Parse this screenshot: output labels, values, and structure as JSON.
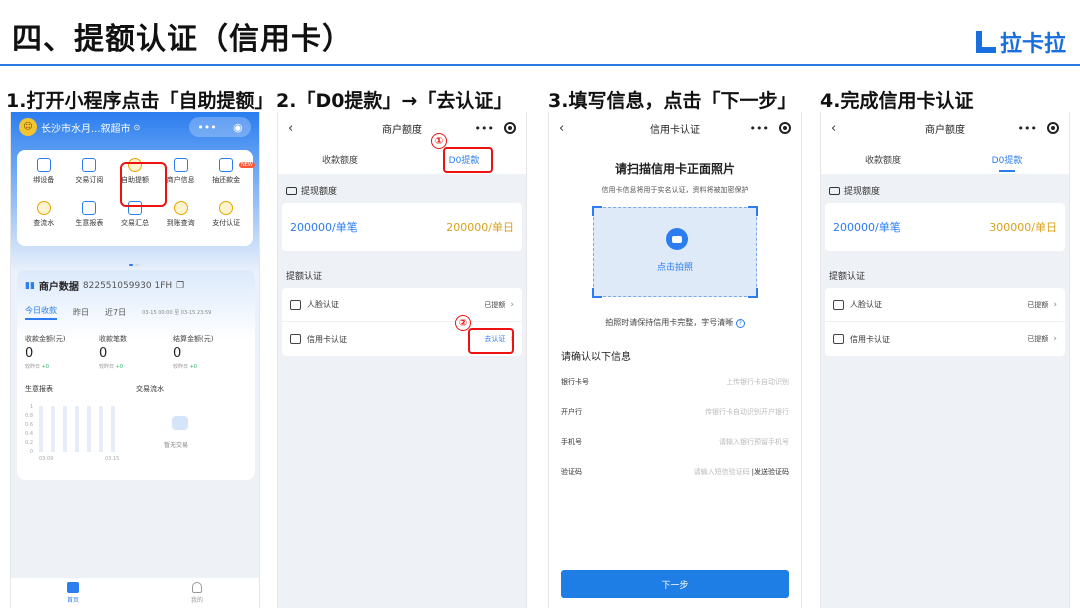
{
  "slide": {
    "title": "四、提额认证（信用卡）",
    "logo": "拉卡拉",
    "steps": [
      "1.打开小程序点击「自助提额」",
      "2.「D0提款」→「去认证」",
      "3.填写信息，点击「下一步」",
      "4.完成信用卡认证"
    ]
  },
  "colors": {
    "accent": "#2b7df0",
    "highlight": "#e11111",
    "quota_gold": "#d9a21a"
  },
  "p1": {
    "store": "长沙市水月...叙超市",
    "caps_more": "•••",
    "grid": [
      "绑设备",
      "交易订阅",
      "自助提额",
      "商户信息",
      "抽还款金",
      "查流水",
      "生意报表",
      "交易汇总",
      "到账查询",
      "支付认证"
    ],
    "data_title": "商户数据",
    "merchant_no": "822551059930 1FH",
    "tabs": [
      "今日收款",
      "昨日",
      "近7日"
    ],
    "range": "03-15 00:00 至 03-15 23:59",
    "metrics": [
      {
        "label": "收款金额(元)",
        "value": "0",
        "yesterday": "较昨日",
        "delta": "+0"
      },
      {
        "label": "收款笔数",
        "value": "0",
        "yesterday": "较昨日",
        "delta": "+0"
      },
      {
        "label": "结算金额(元)",
        "value": "0",
        "yesterday": "较昨日",
        "delta": "+0"
      }
    ],
    "report_label": "生意报表",
    "flow_label": "交易流水",
    "chart_ticks": [
      "1",
      "0.8",
      "0.6",
      "0.4",
      "0.2",
      "0"
    ],
    "chart_dates": [
      "03.09",
      "03.15"
    ],
    "no_trade": "暂无交易",
    "tabbar": [
      "首页",
      "我的"
    ]
  },
  "p2": {
    "title": "商户额度",
    "tabs": [
      "收款额度",
      "D0提款"
    ],
    "withdraw_label": "提现额度",
    "quota_single": "200000/单笔",
    "quota_daily": "200000/单日",
    "auth_title": "提额认证",
    "rows": [
      {
        "label": "人脸认证",
        "status": "已提额"
      },
      {
        "label": "信用卡认证",
        "status": "去认证"
      }
    ],
    "marks": [
      "①",
      "②"
    ]
  },
  "p3": {
    "title": "信用卡认证",
    "heading": "请扫描信用卡正面照片",
    "subtitle": "信用卡信息将用于实名认证，资料将被加密保护",
    "shoot": "点击拍照",
    "tip": "拍照时请保持信用卡完整，字号清晰",
    "confirm": "请确认以下信息",
    "fields": [
      {
        "label": "银行卡号",
        "placeholder": "上传银行卡自动识别"
      },
      {
        "label": "开户行",
        "placeholder": "传银行卡自动识别开户银行"
      },
      {
        "label": "手机号",
        "placeholder": "请输入银行预留手机号"
      },
      {
        "label": "验证码",
        "placeholder": "请输入短信验证码"
      }
    ],
    "send_code": "|发送验证码",
    "next": "下一步"
  },
  "p4": {
    "title": "商户额度",
    "tabs": [
      "收款额度",
      "D0提款"
    ],
    "withdraw_label": "提现额度",
    "quota_single": "200000/单笔",
    "quota_daily": "300000/单日",
    "auth_title": "提额认证",
    "rows": [
      {
        "label": "人脸认证",
        "status": "已提额"
      },
      {
        "label": "信用卡认证",
        "status": "已提额"
      }
    ]
  }
}
